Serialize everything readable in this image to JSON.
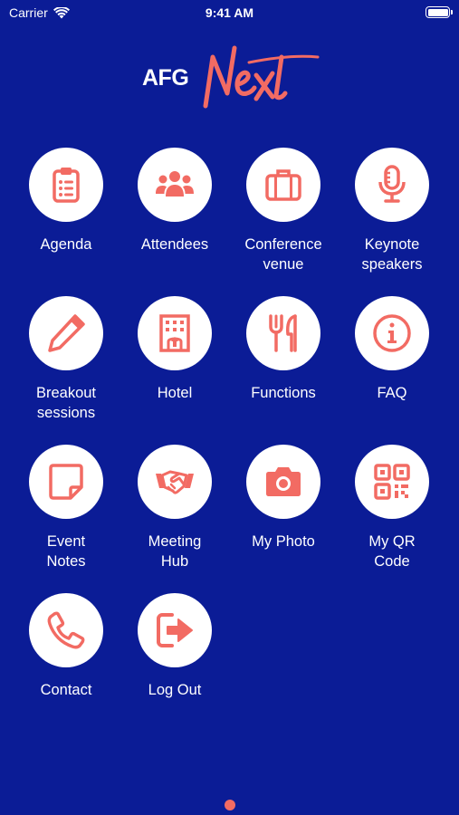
{
  "status_bar": {
    "carrier": "Carrier",
    "time": "9:41 AM"
  },
  "logo": {
    "prefix": "AFG",
    "script": "Next"
  },
  "colors": {
    "background": "#0b1c96",
    "accent": "#f26b63",
    "tile": "#ffffff"
  },
  "menu": {
    "items": [
      {
        "label": "Agenda",
        "icon": "clipboard-icon"
      },
      {
        "label": "Attendees",
        "icon": "people-icon"
      },
      {
        "label": "Conference\nvenue",
        "icon": "briefcase-icon"
      },
      {
        "label": "Keynote\nspeakers",
        "icon": "microphone-icon"
      },
      {
        "label": "Breakout\nsessions",
        "icon": "pencil-icon"
      },
      {
        "label": "Hotel",
        "icon": "building-icon"
      },
      {
        "label": "Functions",
        "icon": "fork-knife-icon"
      },
      {
        "label": "FAQ",
        "icon": "info-icon"
      },
      {
        "label": "Event\nNotes",
        "icon": "sticky-note-icon"
      },
      {
        "label": "Meeting\nHub",
        "icon": "handshake-icon"
      },
      {
        "label": "My Photo",
        "icon": "camera-icon"
      },
      {
        "label": "My QR\nCode",
        "icon": "qr-code-icon"
      },
      {
        "label": "Contact",
        "icon": "phone-icon"
      },
      {
        "label": "Log Out",
        "icon": "sign-out-icon"
      }
    ]
  },
  "pager": {
    "pages": 1,
    "current": 1
  }
}
